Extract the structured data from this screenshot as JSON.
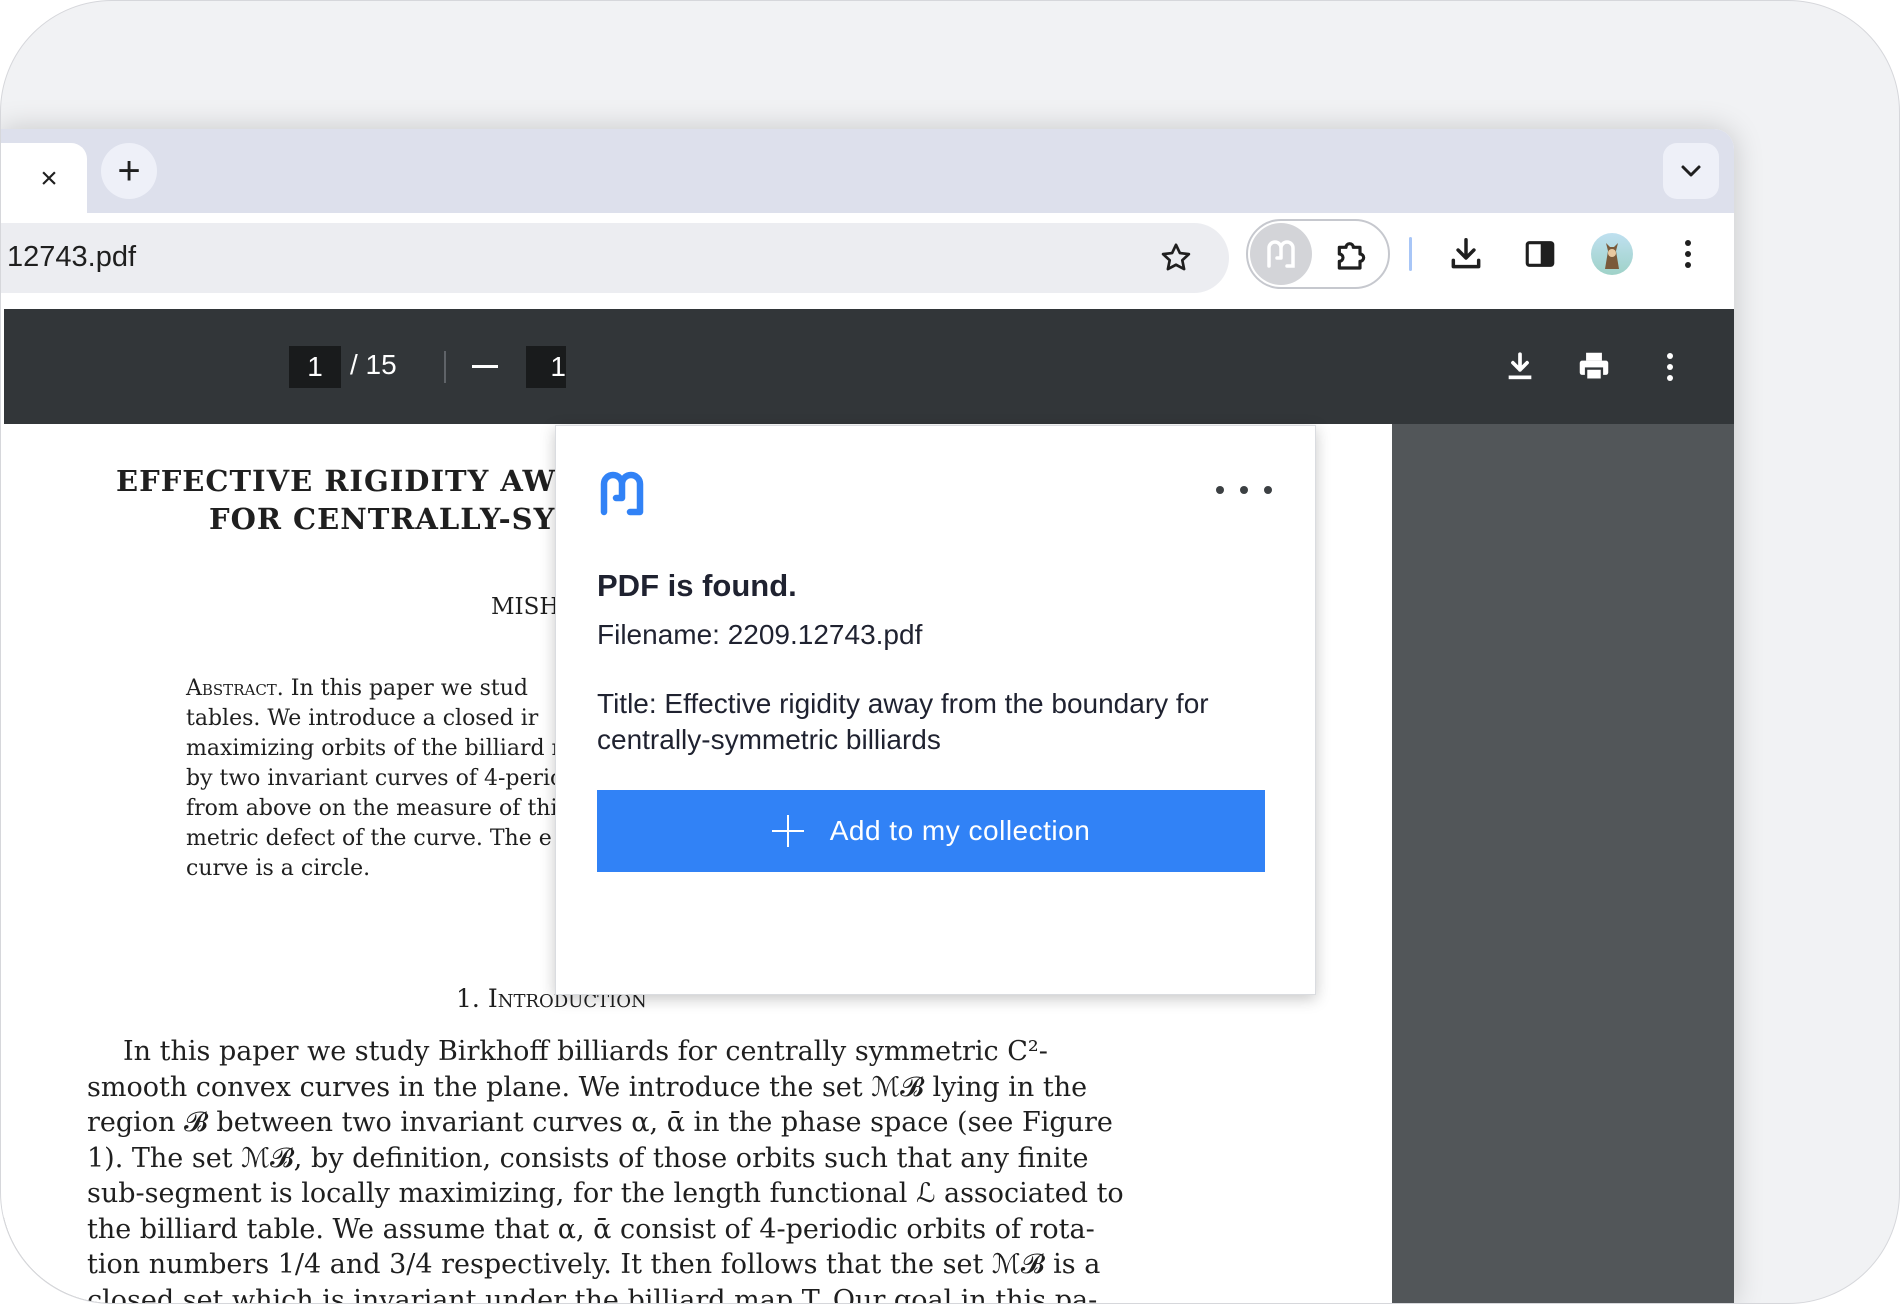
{
  "browser": {
    "tab_close_glyph": "×",
    "new_tab_glyph": "+",
    "url": "12743.pdf"
  },
  "pdf_toolbar": {
    "page_current": "1",
    "page_total": "/ 15",
    "zoom_value": "1"
  },
  "document": {
    "title_line1": "EFFECTIVE RIGIDITY AW",
    "title_line2": "FOR CENTRALLY-SY",
    "authors": "MISH",
    "abstract_label": "Abstract.",
    "abstract_lines": [
      "In this paper we stud",
      "tables.  We introduce a closed ir",
      "maximizing orbits of the billiard r",
      "by two invariant curves of 4-perio",
      "from above on the measure of thi",
      "metric defect of the curve.  The e",
      "curve is a circle."
    ],
    "section_number": "1.",
    "section_title": "Introduction",
    "body_lines": [
      "In this paper we study Birkhoff billiards for centrally symmetric C²-",
      "smooth convex curves in the plane. We introduce the set ℳ𝓑 lying in the",
      "region 𝓑 between two invariant curves α, ᾱ in the phase space (see Figure",
      "1). The set ℳ𝓑, by definition, consists of those orbits such that any finite",
      "sub-segment is locally maximizing, for the length functional ℒ associated to",
      "the billiard table. We assume that α, ᾱ consist of 4-periodic orbits of rota-",
      "tion numbers 1/4 and 3/4 respectively. It then follows that the set ℳ𝓑 is a",
      "closed set which is invariant under the billiard map T. Our goal in this pa-"
    ]
  },
  "popup": {
    "heading": "PDF is found.",
    "filename": "Filename: 2209.12743.pdf",
    "title": "Title: Effective rigidity away from the boundary for centrally-symmetric billiards",
    "add_button_label": "Add to my collection",
    "accent_color": "#3182f6"
  }
}
